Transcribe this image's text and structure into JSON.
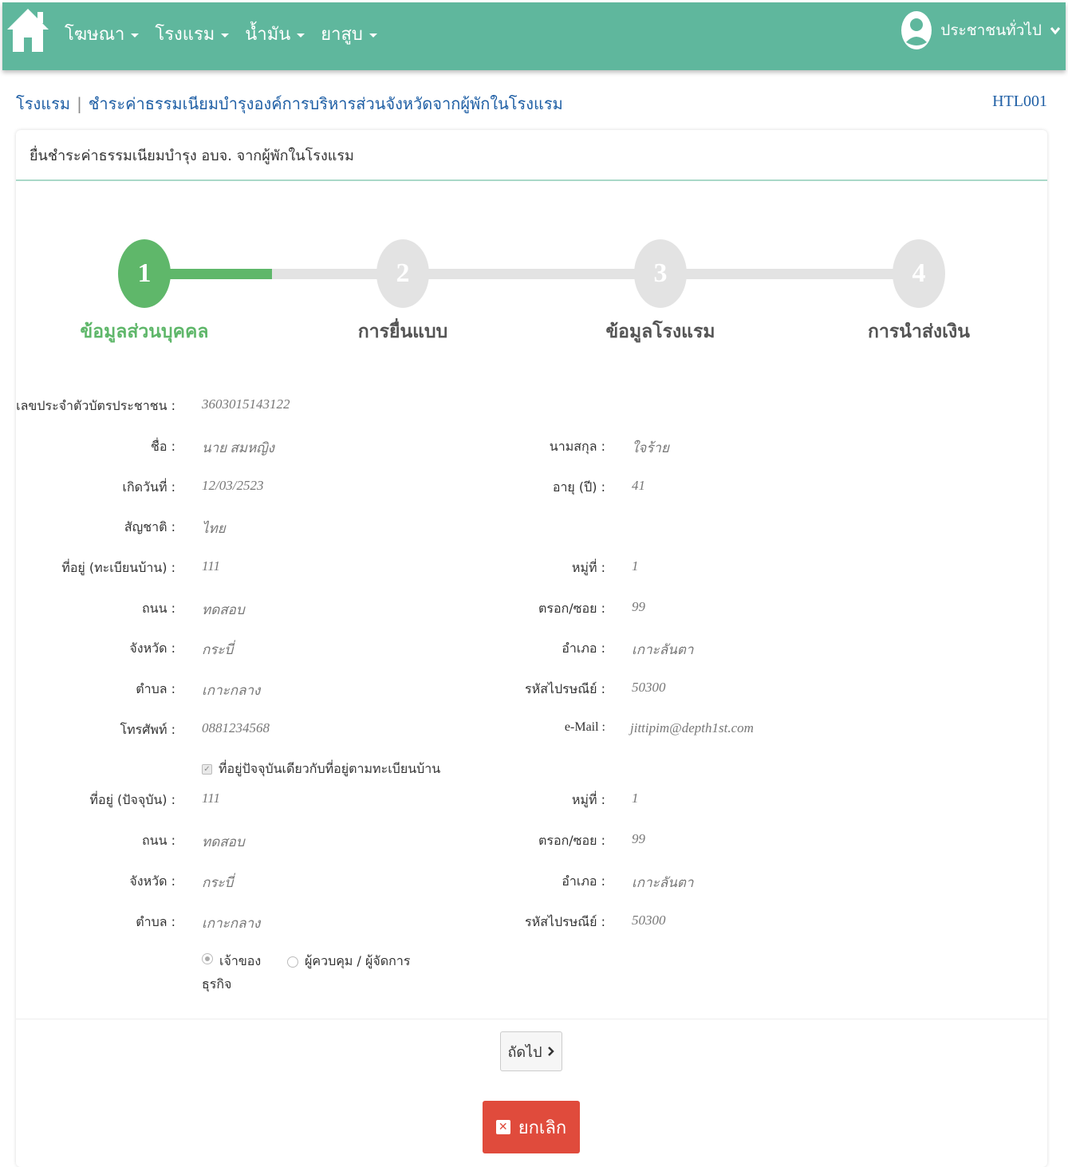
{
  "nav": {
    "items": [
      {
        "label": "โฆษณา"
      },
      {
        "label": "โรงแรม"
      },
      {
        "label": "น้ำมัน"
      },
      {
        "label": "ยาสูบ"
      }
    ],
    "user_label": "ประชาชนทั่วไป"
  },
  "breadcrumb": {
    "section": "โรงแรม",
    "separator": "|",
    "page": "ชำระค่าธรรมเนียมบำรุงองค์การบริหารส่วนจังหวัดจากผู้พักในโรงแรม",
    "code": "HTL001"
  },
  "card": {
    "title": "ยื่นชำระค่าธรรมเนียมบำรุง อบจ. จากผู้พักในโรงแรม"
  },
  "stepper": {
    "progress_fraction": 0.33,
    "active_color": "#5fb76a",
    "inactive_color": "#e3e3e3",
    "steps": [
      {
        "number": "1",
        "label": "ข้อมูลส่วนบุคคล",
        "active": true
      },
      {
        "number": "2",
        "label": "การยื่นแบบ",
        "active": false
      },
      {
        "number": "3",
        "label": "ข้อมูลโรงแรม",
        "active": false
      },
      {
        "number": "4",
        "label": "การนำส่งเงิน",
        "active": false
      }
    ]
  },
  "form": {
    "id_card": {
      "label": "เลขประจำตัวบัตรประชาชน :",
      "value": "3603015143122"
    },
    "first_name": {
      "label": "ชื่อ :",
      "value": "นาย สมหญิง"
    },
    "last_name": {
      "label": "นามสกุล :",
      "value": "ใจร้าย"
    },
    "birth_date": {
      "label": "เกิดวันที่ :",
      "value": "12/03/2523"
    },
    "age": {
      "label": "อายุ (ปี) :",
      "value": "41"
    },
    "nationality": {
      "label": "สัญชาติ :",
      "value": "ไทย"
    },
    "reg_address": {
      "label": "ที่อยู่ (ทะเบียนบ้าน) :",
      "value": "111"
    },
    "reg_moo": {
      "label": "หมู่ที่ :",
      "value": "1"
    },
    "reg_road": {
      "label": "ถนน :",
      "value": "ทดสอบ"
    },
    "reg_soi": {
      "label": "ตรอก/ซอย :",
      "value": "99"
    },
    "reg_province": {
      "label": "จังหวัด :",
      "value": "กระบี่"
    },
    "reg_district": {
      "label": "อำเภอ :",
      "value": "เกาะลันตา"
    },
    "reg_subdistrict": {
      "label": "ตำบล :",
      "value": "เกาะกลาง"
    },
    "reg_postcode": {
      "label": "รหัสไปรษณีย์ :",
      "value": "50300"
    },
    "phone": {
      "label": "โทรศัพท์ :",
      "value": "0881234568"
    },
    "email": {
      "label": "e-Mail :",
      "value": "jittipim@depth1st.com"
    },
    "same_address": {
      "label": "ที่อยู่ปัจจุบันเดียวกับที่อยู่ตามทะเบียนบ้าน",
      "checked": true
    },
    "cur_address": {
      "label": "ที่อยู่ (ปัจจุบัน) :",
      "value": "111"
    },
    "cur_moo": {
      "label": "หมู่ที่ :",
      "value": "1"
    },
    "cur_road": {
      "label": "ถนน :",
      "value": "ทดสอบ"
    },
    "cur_soi": {
      "label": "ตรอก/ซอย :",
      "value": "99"
    },
    "cur_province": {
      "label": "จังหวัด :",
      "value": "กระบี่"
    },
    "cur_district": {
      "label": "อำเภอ :",
      "value": "เกาะลันตา"
    },
    "cur_subdistrict": {
      "label": "ตำบล :",
      "value": "เกาะกลาง"
    },
    "cur_postcode": {
      "label": "รหัสไปรษณีย์ :",
      "value": "50300"
    },
    "role_owner": {
      "label": "เจ้าของ",
      "label2": "ธุรกิจ",
      "selected": true
    },
    "role_manager": {
      "label": "ผู้ควบคุม / ผู้จัดการ",
      "selected": false
    }
  },
  "actions": {
    "next_label": "ถัดไป",
    "cancel_label": "ยกเลิก"
  },
  "colors": {
    "topbar": "#5fb79d",
    "link": "#1f5fa5",
    "cancel": "#e04b3c"
  }
}
